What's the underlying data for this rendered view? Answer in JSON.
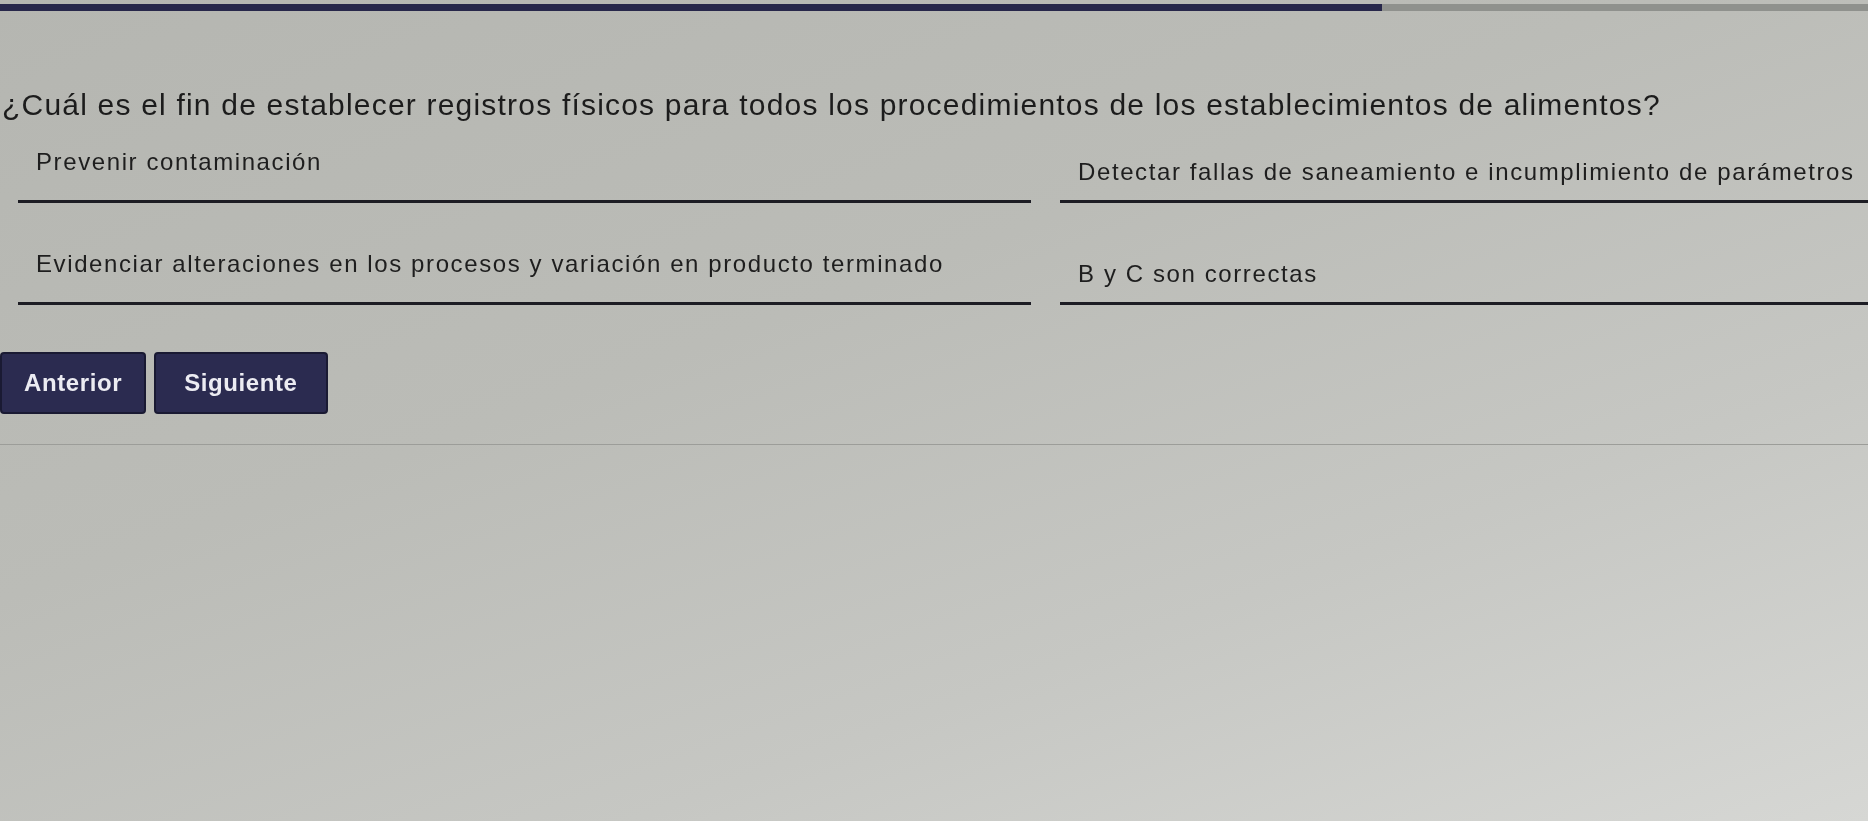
{
  "progress": {
    "level": 0.74
  },
  "question": {
    "text": "¿Cuál es el fin de establecer registros físicos para todos los procedimientos de los establecimientos de alimentos?"
  },
  "options": [
    {
      "label": "Prevenir contaminación"
    },
    {
      "label": "Detectar fallas de saneamiento e incumplimiento de parámetros"
    },
    {
      "label": "Evidenciar alteraciones en los procesos y variación en producto terminado"
    },
    {
      "label": "B y C son correctas"
    }
  ],
  "buttons": [
    {
      "label": "Anterior"
    },
    {
      "label": "Siguiente"
    }
  ]
}
